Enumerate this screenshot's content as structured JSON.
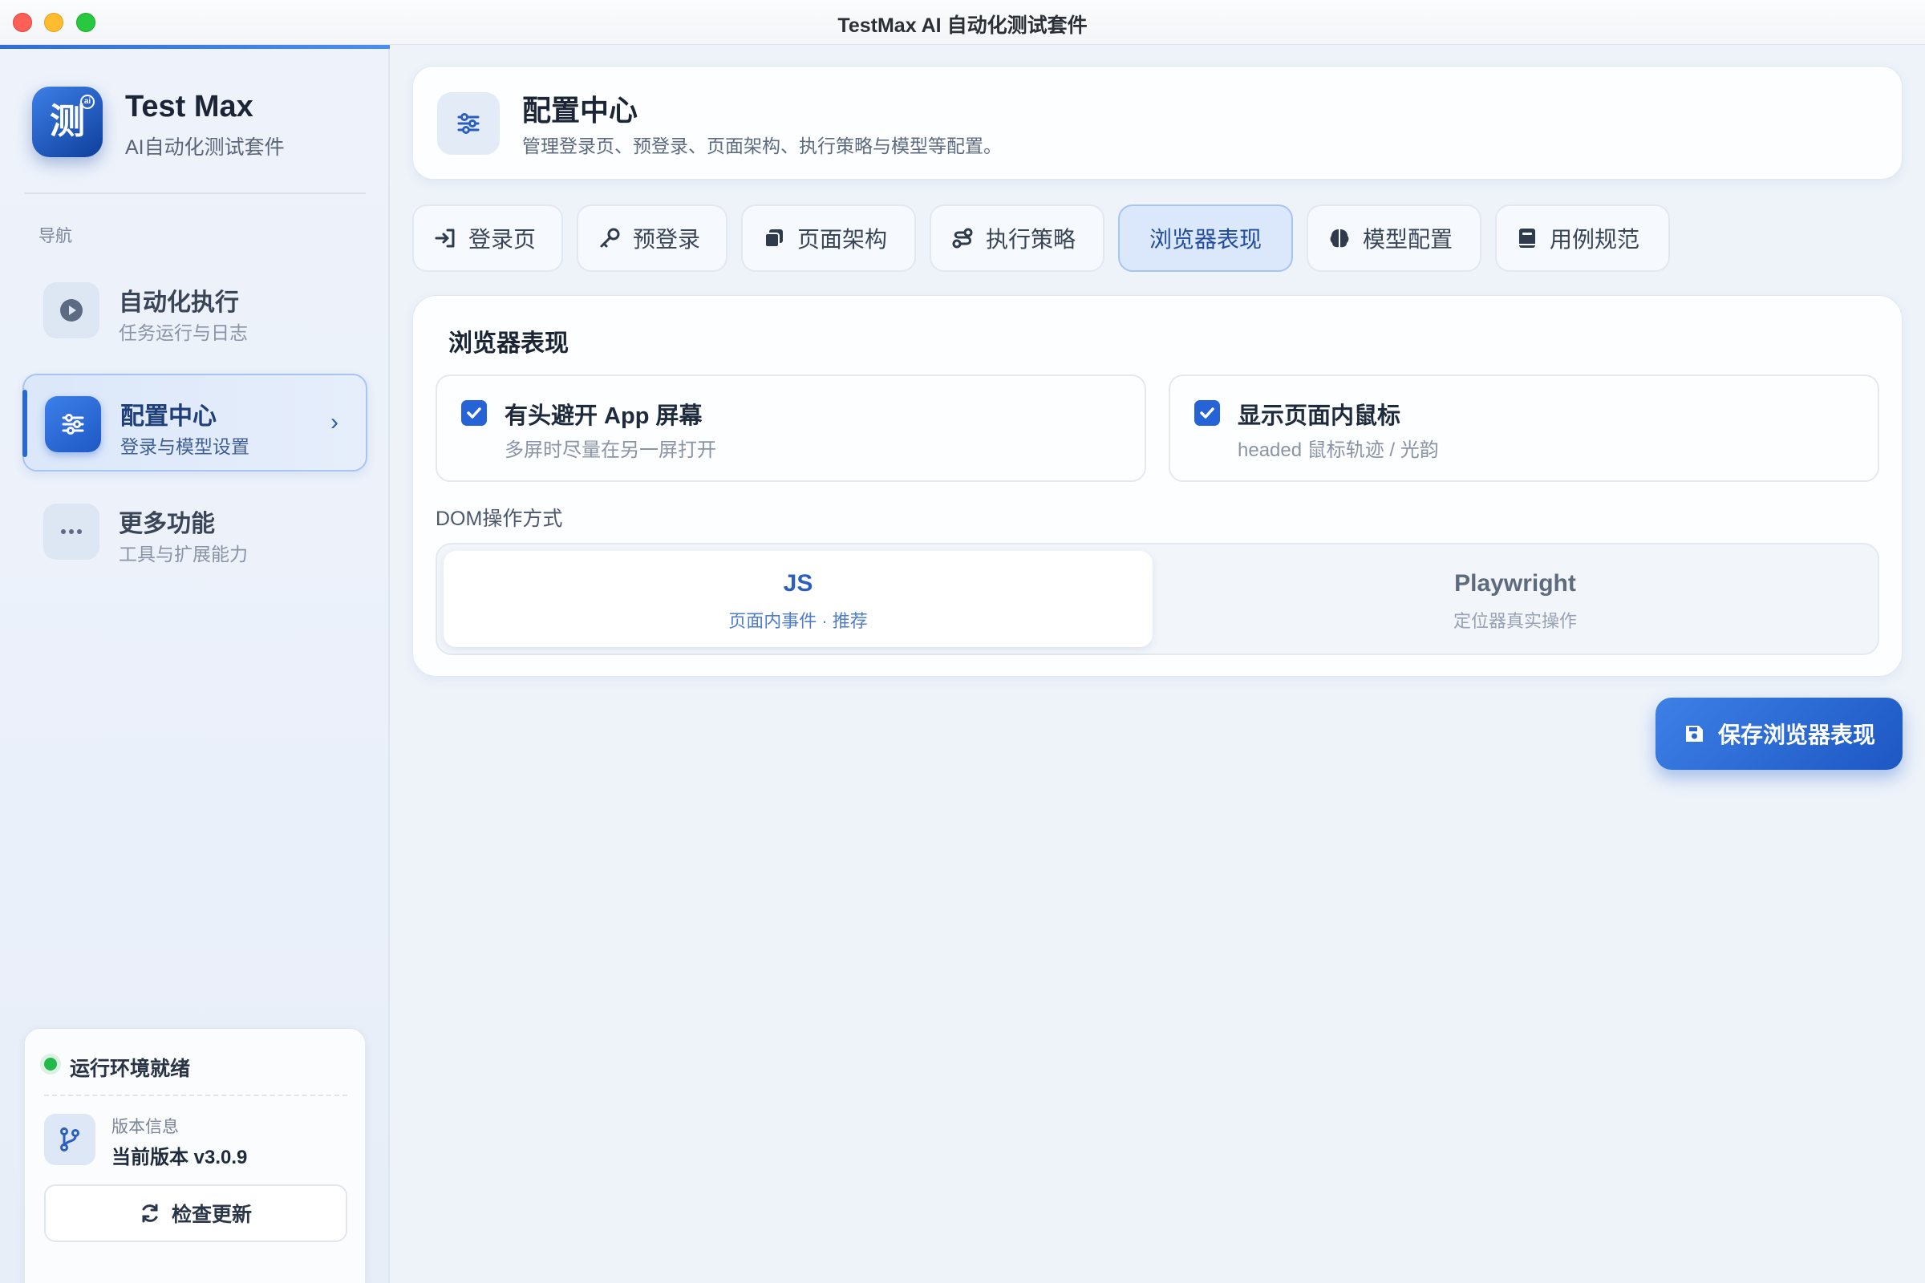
{
  "window": {
    "title": "TestMax AI 自动化测试套件"
  },
  "brand": {
    "logo_char": "测",
    "logo_badge": "ai",
    "name": "Test Max",
    "subtitle": "AI自动化测试套件"
  },
  "sidebar": {
    "nav_heading": "导航",
    "items": [
      {
        "title": "自动化执行",
        "subtitle": "任务运行与日志",
        "icon": "play-icon"
      },
      {
        "title": "配置中心",
        "subtitle": "登录与模型设置",
        "icon": "sliders-icon",
        "active": true
      },
      {
        "title": "更多功能",
        "subtitle": "工具与扩展能力",
        "icon": "more-icon"
      }
    ],
    "env": {
      "status": "运行环境就绪",
      "status_color": "#22b84a",
      "version_label": "版本信息",
      "version_value": "当前版本 v3.0.9",
      "check_update": "检查更新"
    }
  },
  "header": {
    "title": "配置中心",
    "subtitle": "管理登录页、预登录、页面架构、执行策略与模型等配置。"
  },
  "tabs": [
    {
      "label": "登录页",
      "icon": "login-icon"
    },
    {
      "label": "预登录",
      "icon": "key-icon"
    },
    {
      "label": "页面架构",
      "icon": "layers-icon"
    },
    {
      "label": "执行策略",
      "icon": "route-icon"
    },
    {
      "label": "浏览器表现",
      "active": true
    },
    {
      "label": "模型配置",
      "icon": "brain-icon"
    },
    {
      "label": "用例规范",
      "icon": "book-icon"
    }
  ],
  "browser": {
    "section_title": "浏览器表现",
    "options": [
      {
        "title": "有头避开 App 屏幕",
        "subtitle": "多屏时尽量在另一屏打开",
        "checked": true
      },
      {
        "title": "显示页面内鼠标",
        "subtitle": "headed 鼠标轨迹 / 光韵",
        "checked": true
      }
    ],
    "dom_label": "DOM操作方式",
    "dom_modes": [
      {
        "title": "JS",
        "subtitle": "页面内事件 · 推荐",
        "selected": true
      },
      {
        "title": "Playwright",
        "subtitle": "定位器真实操作",
        "selected": false
      }
    ],
    "save_button": "保存浏览器表现"
  },
  "colors": {
    "accent": "#2563d6",
    "accent_light": "#dbe7fa"
  }
}
